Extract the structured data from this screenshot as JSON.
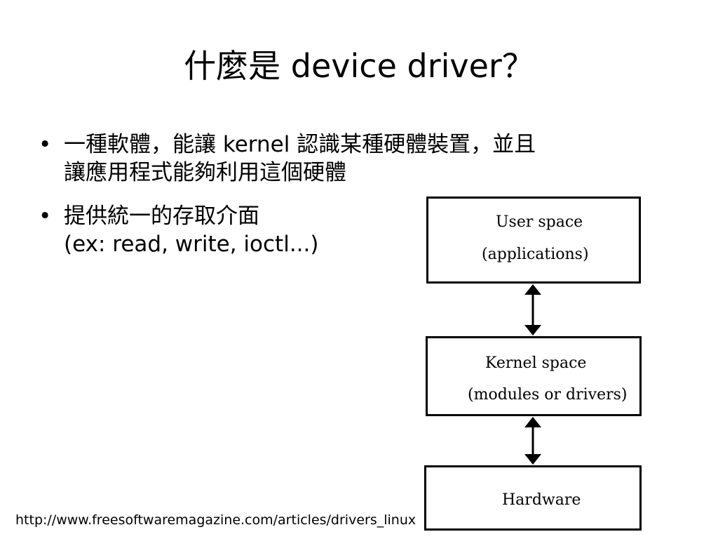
{
  "slide": {
    "title": "什麼是 device driver？",
    "bullets": [
      {
        "marker": "•",
        "lines": [
          "一種軟體，能讓 kernel 認識某種硬體裝置，並且",
          "讓應用程式能夠利用這個硬體"
        ]
      },
      {
        "marker": "•",
        "lines": [
          "提供統一的存取介面",
          "(ex: read, write, ioctl...)"
        ]
      }
    ],
    "source_url": "http://www.freesoftwaremagazine.com/articles/drivers_linux"
  },
  "diagram": {
    "nodes": [
      {
        "id": "user-space",
        "lines": [
          "User space",
          "(applications)"
        ]
      },
      {
        "id": "kernel-space",
        "lines": [
          "Kernel space",
          "(modules or drivers)"
        ]
      },
      {
        "id": "hardware",
        "lines": [
          "Hardware"
        ]
      }
    ],
    "edges": [
      {
        "from": "user-space",
        "to": "kernel-space",
        "direction": "bidirectional"
      },
      {
        "from": "kernel-space",
        "to": "hardware",
        "direction": "bidirectional"
      }
    ],
    "colors": {
      "stroke": "#000000",
      "fill": "#ffffff"
    }
  }
}
